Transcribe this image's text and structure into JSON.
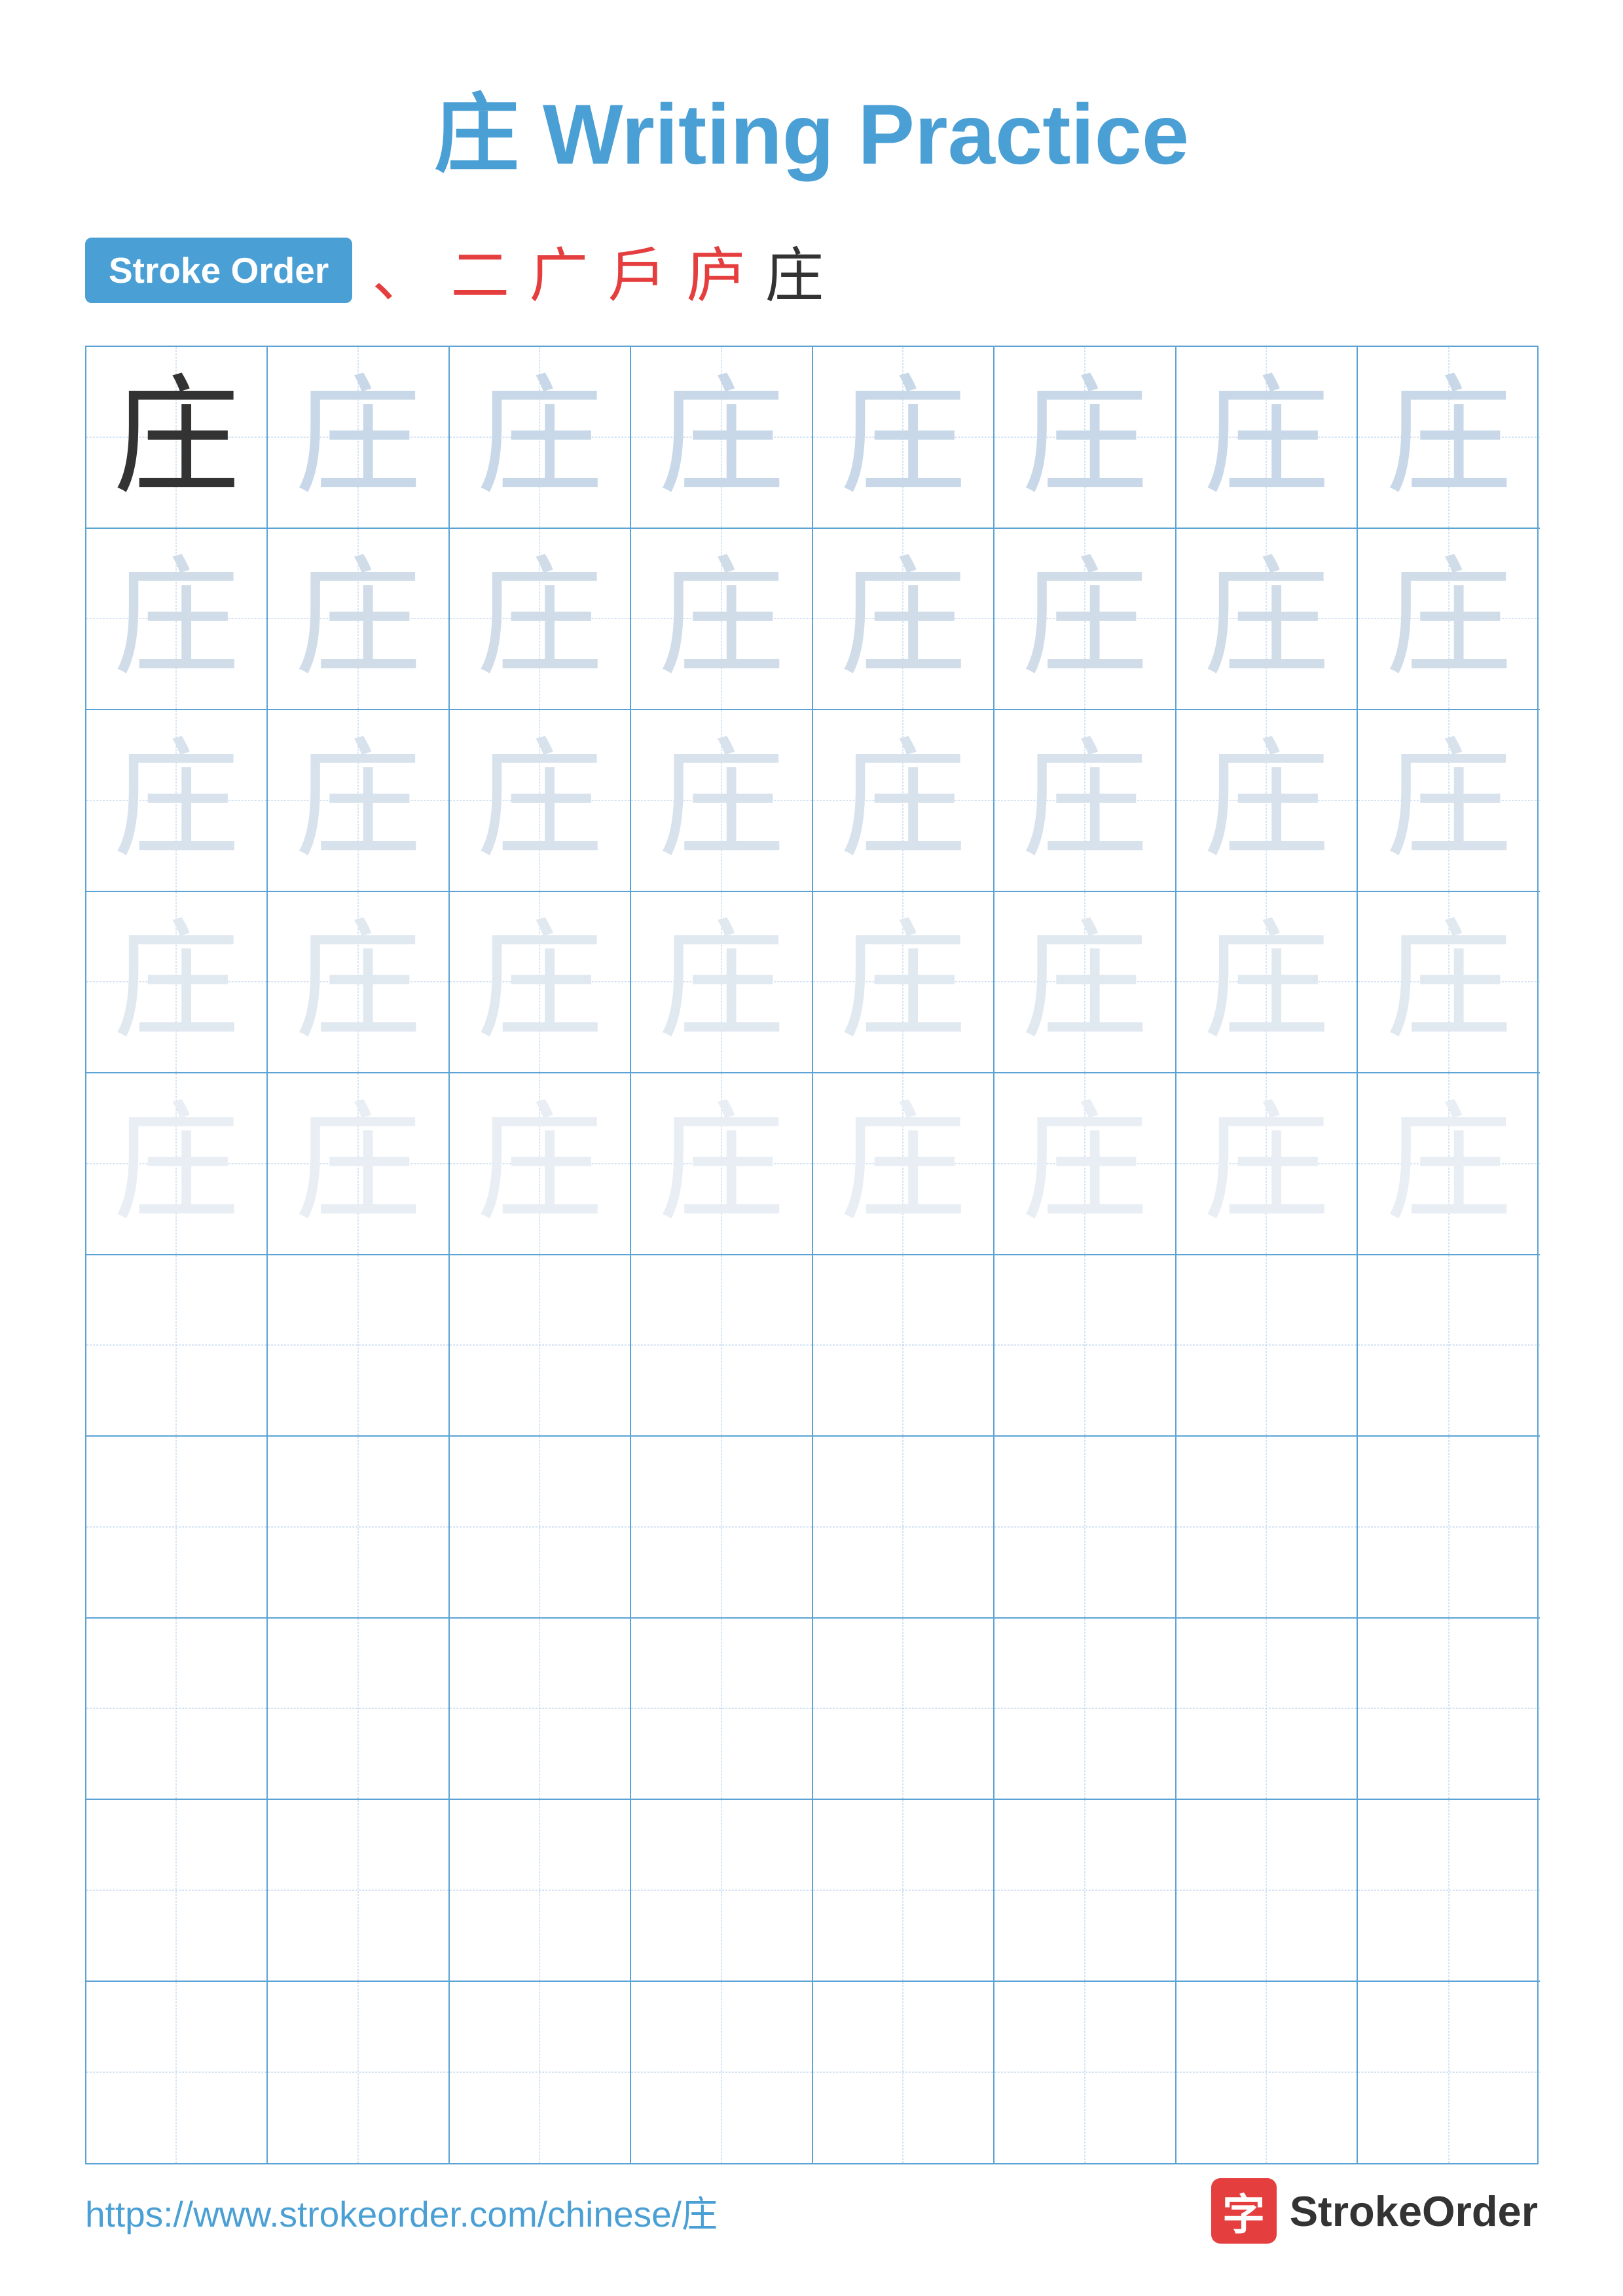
{
  "title": {
    "character": "庄",
    "text": "庄 Writing Practice"
  },
  "stroke_order": {
    "badge_label": "Stroke Order",
    "strokes": [
      "﹀",
      "二",
      "广",
      "戶",
      "庐",
      "庄"
    ]
  },
  "grid": {
    "rows": 10,
    "cols": 8,
    "character": "庄",
    "practice_rows": 5,
    "empty_rows": 5
  },
  "footer": {
    "url": "https://www.strokeorder.com/chinese/庄",
    "brand_icon": "字",
    "brand_name": "StrokeOrder"
  }
}
